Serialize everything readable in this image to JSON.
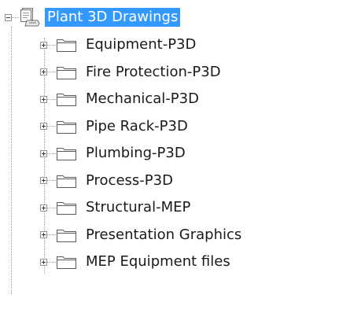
{
  "tree": {
    "root": {
      "label": "Plant 3D Drawings",
      "icon": "drawing-set-icon",
      "expanded": true,
      "selected": true
    },
    "folders": [
      {
        "label": "Equipment-P3D",
        "icon": "folder-icon"
      },
      {
        "label": "Fire Protection-P3D",
        "icon": "folder-icon"
      },
      {
        "label": "Mechanical-P3D",
        "icon": "folder-icon"
      },
      {
        "label": "Pipe Rack-P3D",
        "icon": "folder-icon"
      },
      {
        "label": "Plumbing-P3D",
        "icon": "folder-icon"
      },
      {
        "label": "Process-P3D",
        "icon": "folder-icon"
      },
      {
        "label": "Structural-MEP",
        "icon": "folder-icon"
      },
      {
        "label": "Presentation Graphics",
        "icon": "folder-icon"
      },
      {
        "label": "MEP Equipment files",
        "icon": "folder-icon"
      }
    ]
  },
  "colors": {
    "selection_bg": "#3399ff",
    "selection_text": "#ffffff",
    "text": "#1a1a1a",
    "guide_line": "#a0a0a0"
  }
}
